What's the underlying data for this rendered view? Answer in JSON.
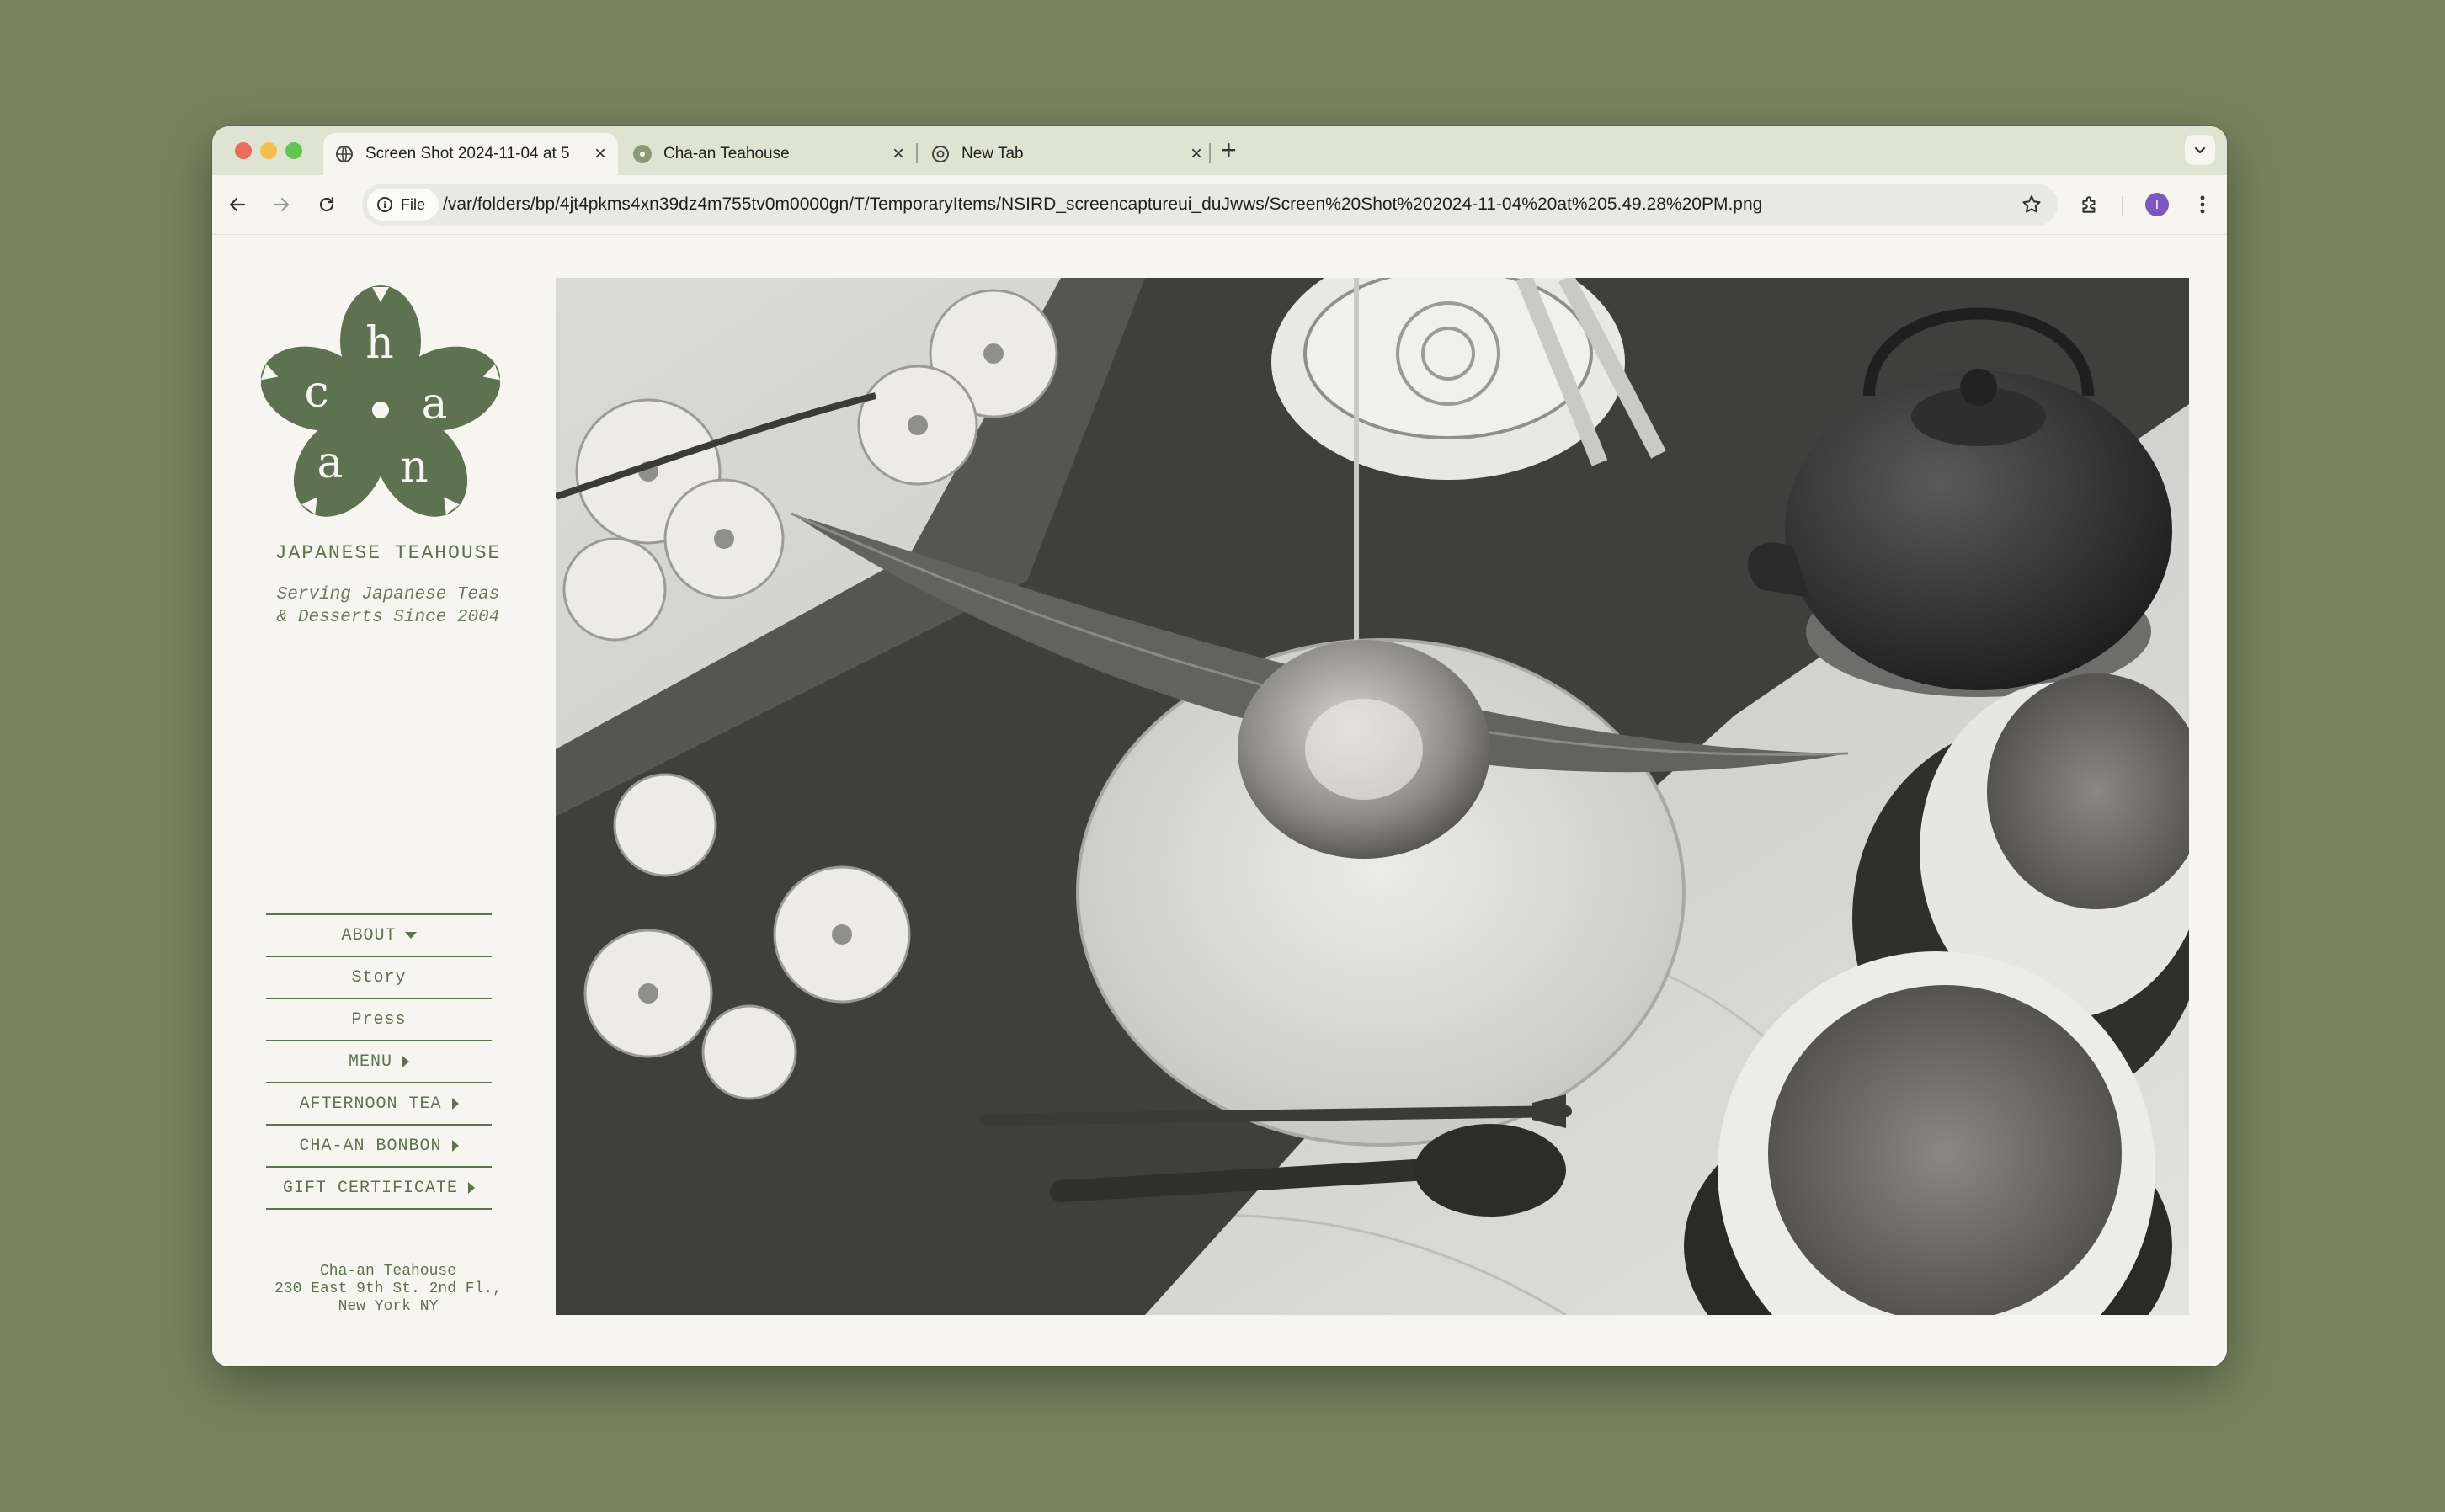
{
  "browser": {
    "tabs": [
      {
        "title": "Screen Shot 2024-11-04 at 5",
        "active": true
      },
      {
        "title": "Cha-an Teahouse",
        "active": false
      },
      {
        "title": "New Tab",
        "active": false
      }
    ],
    "new_tab_label": "+",
    "address_chip": "File",
    "url": "/var/folders/bp/4jt4pkms4xn39dz4m755tv0m0000gn/T/TemporaryItems/NSIRD_screencaptureui_duJwws/Screen%20Shot%202024-11-04%20at%205.49.28%20PM.png",
    "profile_initial": "I",
    "icons": [
      "back-arrow-icon",
      "forward-arrow-icon",
      "reload-icon",
      "info-icon",
      "star-icon",
      "extensions-icon",
      "kebab-menu-icon",
      "chevron-down-icon"
    ]
  },
  "site": {
    "logo_letters": [
      "c",
      "h",
      "a",
      "a",
      "n"
    ],
    "subtitle": "JAPANESE TEAHOUSE",
    "tagline_line1": "Serving Japanese Teas",
    "tagline_line2": "& Desserts Since 2004",
    "nav": [
      {
        "label": "ABOUT",
        "indicator": "caret-down"
      },
      {
        "label": "Story",
        "indicator": "none"
      },
      {
        "label": "Press",
        "indicator": "none"
      },
      {
        "label": "MENU",
        "indicator": "caret-right"
      },
      {
        "label": "AFTERNOON TEA",
        "indicator": "caret-right"
      },
      {
        "label": "CHA-AN BONBON",
        "indicator": "caret-right"
      },
      {
        "label": "GIFT CERTIFICATE",
        "indicator": "caret-right"
      }
    ],
    "address_line1": "Cha-an Teahouse",
    "address_line2": "230 East 9th St. 2nd Fl.,",
    "address_line3": "New York NY"
  },
  "colors": {
    "background": "#77845e",
    "brand_green": "#5e7150",
    "page_bg": "#f6f5f0",
    "tabstrip_bg": "#dfe4d2"
  }
}
